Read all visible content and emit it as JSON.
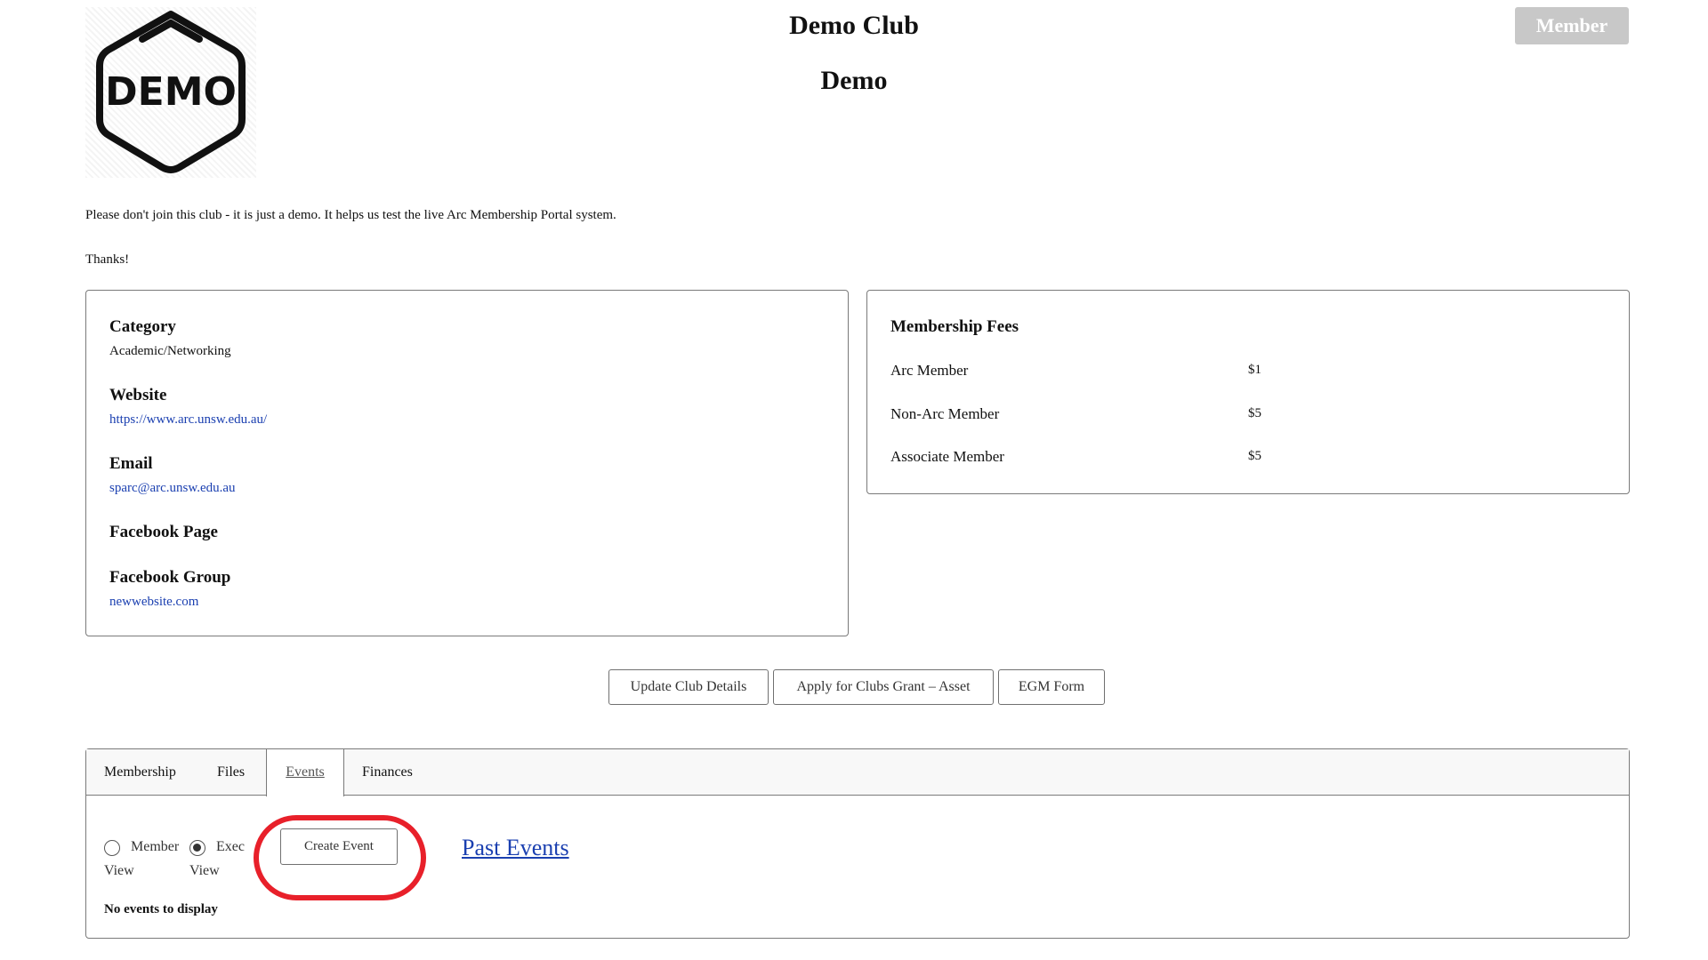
{
  "header": {
    "logo_text": "DEMO",
    "title": "Demo Club",
    "subtitle": "Demo",
    "member_button": "Member"
  },
  "description": "Please don't join this club - it is just a demo. It helps us test the live Arc Membership Portal system.",
  "thanks": "Thanks!",
  "details": {
    "category_label": "Category",
    "category_value": "Academic/Networking",
    "website_label": "Website",
    "website_value": "https://www.arc.unsw.edu.au/",
    "email_label": "Email",
    "email_value": "sparc@arc.unsw.edu.au",
    "facebook_page_label": "Facebook Page",
    "facebook_group_label": "Facebook Group",
    "facebook_group_value": "newwebsite.com"
  },
  "fees": {
    "title": "Membership Fees",
    "items": [
      {
        "name": "Arc Member",
        "amount": "$1"
      },
      {
        "name": "Non-Arc Member",
        "amount": "$5"
      },
      {
        "name": "Associate Member",
        "amount": "$5"
      }
    ]
  },
  "actions": {
    "update": "Update Club Details",
    "grant": "Apply for Clubs Grant – Asset",
    "egm": "EGM Form"
  },
  "tabs": {
    "membership": "Membership",
    "files": "Files",
    "events": "Events",
    "finances": "Finances",
    "active": "Events"
  },
  "events": {
    "view_member_line1": "Member",
    "view_member_line2": "View",
    "view_exec_line1": "Exec",
    "view_exec_line2": "View",
    "selected_view": "Exec View",
    "create_button": "Create Event",
    "past_events_link": "Past Events",
    "empty_message": "No events to display"
  },
  "colors": {
    "link": "#1a3fb0",
    "highlight_ring": "#e8202a",
    "member_button_bg": "#c8c8c8"
  }
}
